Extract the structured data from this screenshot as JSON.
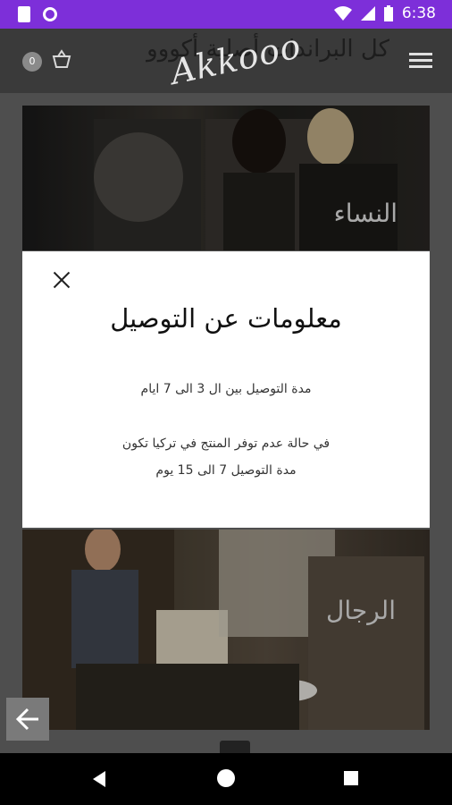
{
  "status_bar": {
    "time": "6:38",
    "background_color": "#7d2fd9"
  },
  "app_bar": {
    "title": "كل البراندات أصلية أكووو",
    "logo_text": "Akkooo",
    "cart_count": "0",
    "icons": {
      "cart": "shopping-basket-icon",
      "menu": "hamburger-menu-icon"
    }
  },
  "banners": {
    "women": {
      "label": "النساء"
    },
    "men": {
      "label": "الرجال"
    }
  },
  "modal": {
    "title": "معلومات عن التوصيل",
    "line1": "مدة التوصيل بين ال 3 الى 7 ايام",
    "line2": "في حالة عدم توفر المنتج في تركيا تكون",
    "line3": "مدة التوصيل  7 الى 15 يوم",
    "close_icon": "close-icon"
  },
  "floating": {
    "back_icon": "arrow-left-icon"
  },
  "nav_bar": {
    "back": "nav-back-icon",
    "home": "nav-home-icon",
    "recents": "nav-recents-icon"
  }
}
